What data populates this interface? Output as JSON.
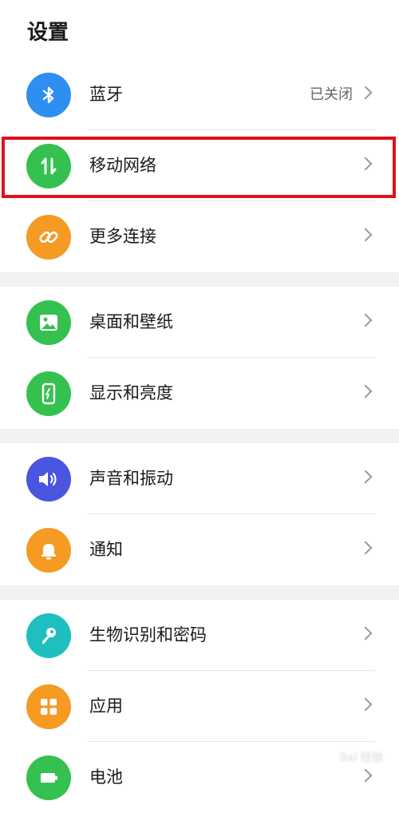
{
  "header": {
    "title": "设置"
  },
  "groups": [
    {
      "items": [
        {
          "label": "蓝牙",
          "value": "已关闭",
          "icon": "bluetooth-icon",
          "color": "#2e8ff0"
        },
        {
          "label": "移动网络",
          "value": "",
          "icon": "mobile-network-icon",
          "color": "#35c14f"
        },
        {
          "label": "更多连接",
          "value": "",
          "icon": "link-icon",
          "color": "#f59a22"
        }
      ]
    },
    {
      "items": [
        {
          "label": "桌面和壁纸",
          "value": "",
          "icon": "wallpaper-icon",
          "color": "#35c14f"
        },
        {
          "label": "显示和亮度",
          "value": "",
          "icon": "display-brightness-icon",
          "color": "#35c14f"
        }
      ]
    },
    {
      "items": [
        {
          "label": "声音和振动",
          "value": "",
          "icon": "volume-icon",
          "color": "#4a55e0"
        },
        {
          "label": "通知",
          "value": "",
          "icon": "bell-icon",
          "color": "#f59a22"
        }
      ]
    },
    {
      "items": [
        {
          "label": "生物识别和密码",
          "value": "",
          "icon": "key-icon",
          "color": "#1fbfc0"
        },
        {
          "label": "应用",
          "value": "",
          "icon": "apps-icon",
          "color": "#f59a22"
        },
        {
          "label": "电池",
          "value": "",
          "icon": "battery-icon",
          "color": "#35c14f"
        }
      ]
    }
  ],
  "watermark": "Bai 经验"
}
